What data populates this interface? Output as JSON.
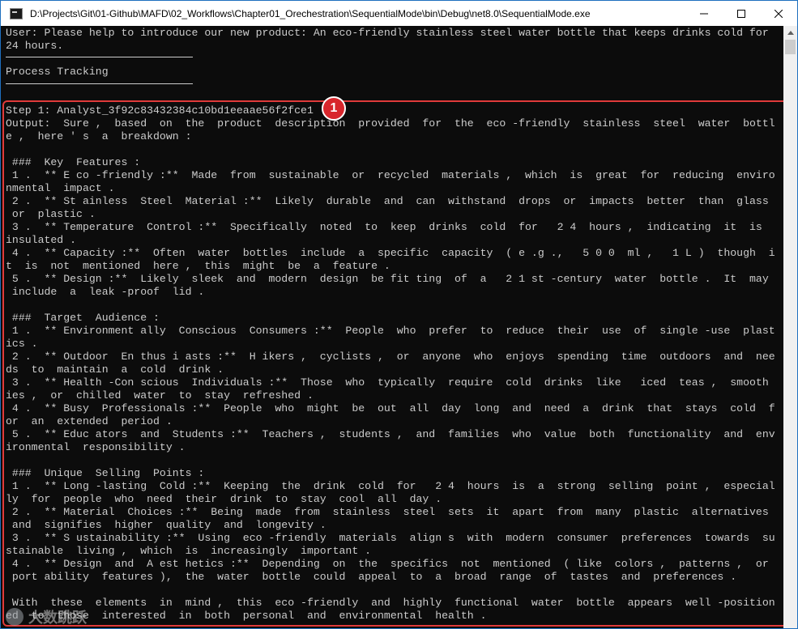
{
  "window": {
    "title": "D:\\Projects\\Git\\01-Github\\MAFD\\02_Workflows\\Chapter01_Orechestration\\SequentialMode\\bin\\Debug\\net8.0\\SequentialMode.exe",
    "controls": {
      "minimize": "minimize-icon",
      "maximize": "maximize-icon",
      "close": "close-icon"
    }
  },
  "console": {
    "lines": [
      "User: Please help to introduce our new product: An eco-friendly stainless steel water bottle that keeps drinks cold for",
      "24 hours.",
      "",
      "Process Tracking",
      "",
      "Step 1: Analyst_3f92c83432384c10bd1eeaae56f2fce1",
      "Output:  Sure ,  based  on  the  product  description  provided  for  the  eco -friendly  stainless  steel  water  bottl",
      "e ,  here ' s  a  breakdown :",
      "",
      " ###  Key  Features :",
      " 1 .  ** E co -friendly :**  Made  from  sustainable  or  recycled  materials ,  which  is  great  for  reducing  enviro",
      "nmental  impact .",
      " 2 .  ** St ainless  Steel  Material :**  Likely  durable  and  can  withstand  drops  or  impacts  better  than  glass",
      " or  plastic .",
      " 3 .  ** Temperature  Control :**  Specifically  noted  to  keep  drinks  cold  for   2 4  hours ,  indicating  it  is",
      "insulated .",
      " 4 .  ** Capacity :**  Often  water  bottles  include  a  specific  capacity  ( e .g .,   5 0 0  ml ,   1 L )  though  i",
      "t  is  not  mentioned  here ,  this  might  be  a  feature .",
      " 5 .  ** Design :**  Likely  sleek  and  modern  design  be fit ting  of  a   2 1 st -century  water  bottle .  It  may",
      " include  a  leak -proof  lid .",
      "",
      " ###  Target  Audience :",
      " 1 .  ** Environment ally  Conscious  Consumers :**  People  who  prefer  to  reduce  their  use  of  single -use  plast",
      "ics .",
      " 2 .  ** Outdoor  En thus i asts :**  H ikers ,  cyclists ,  or  anyone  who  enjoys  spending  time  outdoors  and  nee",
      "ds  to  maintain  a  cold  drink .",
      " 3 .  ** Health -Con scious  Individuals :**  Those  who  typically  require  cold  drinks  like   iced  teas ,  smooth",
      "ies ,  or  chilled  water  to  stay  refreshed .",
      " 4 .  ** Busy  Professionals :**  People  who  might  be  out  all  day  long  and  need  a  drink  that  stays  cold  f",
      "or  an  extended  period .",
      " 5 .  ** Educ ators  and  Students :**  Teachers ,  students ,  and  families  who  value  both  functionality  and  env",
      "ironmental  responsibility .",
      "",
      " ###  Unique  Selling  Points :",
      " 1 .  ** Long -lasting  Cold :**  Keeping  the  drink  cold  for   2 4  hours  is  a  strong  selling  point ,  especial",
      "ly  for  people  who  need  their  drink  to  stay  cool  all  day .",
      " 2 .  ** Material  Choices :**  Being  made  from  stainless  steel  sets  it  apart  from  many  plastic  alternatives",
      " and  signifies  higher  quality  and  longevity .",
      " 3 .  ** S ustainability :**  Using  eco -friendly  materials  align s  with  modern  consumer  preferences  towards  su",
      "stainable  living ,  which  is  increasingly  important .",
      " 4 .  ** Design  and  A est hetics :**  Depending  on  the  specifics  not  mentioned  ( like  colors ,  patterns ,  or",
      " port ability  features ),  the  water  bottle  could  appeal  to  a  broad  range  of  tastes  and  preferences .",
      "",
      " With  these  elements  in  mind ,  this  eco -friendly  and  highly  functional  water  bottle  appears  well -position",
      "ed  to  those  interested  in  both  personal  and  environmental  health ."
    ]
  },
  "annotation": {
    "badge_number": "1",
    "color": "#e03a3a"
  },
  "watermark": {
    "text": "大数跳跃"
  },
  "colors": {
    "console_bg": "#0c0c0c",
    "console_text": "#cccccc",
    "highlight": "#e03a3a"
  }
}
